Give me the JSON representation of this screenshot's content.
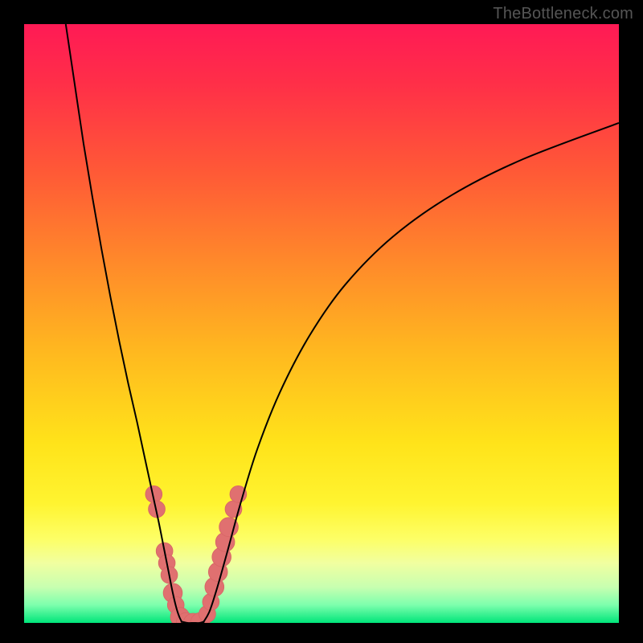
{
  "watermark": "TheBottleneck.com",
  "colors": {
    "black": "#000000",
    "curve": "#000000",
    "marker_fill": "#e07070",
    "marker_stroke": "#d86666"
  },
  "chart_data": {
    "type": "line",
    "title": "",
    "xlabel": "",
    "ylabel": "",
    "xlim": [
      0,
      100
    ],
    "ylim": [
      0,
      100
    ],
    "gradient_stops": [
      {
        "offset": 0.0,
        "color": "#ff1a55"
      },
      {
        "offset": 0.1,
        "color": "#ff2f48"
      },
      {
        "offset": 0.25,
        "color": "#ff5a36"
      },
      {
        "offset": 0.4,
        "color": "#ff8a2a"
      },
      {
        "offset": 0.55,
        "color": "#ffb91f"
      },
      {
        "offset": 0.7,
        "color": "#ffe31a"
      },
      {
        "offset": 0.8,
        "color": "#fff430"
      },
      {
        "offset": 0.86,
        "color": "#fdff66"
      },
      {
        "offset": 0.9,
        "color": "#f1ffa0"
      },
      {
        "offset": 0.94,
        "color": "#c8ffb0"
      },
      {
        "offset": 0.97,
        "color": "#7dffad"
      },
      {
        "offset": 1.0,
        "color": "#00e57a"
      }
    ],
    "series": [
      {
        "name": "left-branch",
        "x": [
          7.0,
          8.5,
          10.0,
          11.5,
          13.0,
          14.5,
          16.0,
          17.5,
          19.0,
          20.3,
          21.5,
          22.6,
          23.5,
          24.3,
          25.0,
          25.6,
          26.1,
          26.5
        ],
        "y": [
          100.0,
          90.0,
          80.0,
          71.0,
          62.5,
          54.5,
          47.0,
          40.0,
          33.5,
          27.5,
          22.0,
          17.0,
          12.5,
          8.5,
          5.0,
          2.5,
          1.0,
          0.2
        ]
      },
      {
        "name": "flat-valley",
        "x": [
          26.5,
          27.5,
          28.5,
          29.5,
          30.2
        ],
        "y": [
          0.2,
          0.0,
          0.0,
          0.0,
          0.2
        ]
      },
      {
        "name": "right-branch",
        "x": [
          30.2,
          31.2,
          32.5,
          34.2,
          36.4,
          39.2,
          43.0,
          48.0,
          54.0,
          62.0,
          72.0,
          84.0,
          100.0
        ],
        "y": [
          0.2,
          2.0,
          6.0,
          12.0,
          20.0,
          29.0,
          38.5,
          48.0,
          56.5,
          64.5,
          71.5,
          77.5,
          83.5
        ]
      }
    ],
    "markers": [
      {
        "x": 21.8,
        "y": 21.5,
        "r": 1.4
      },
      {
        "x": 22.3,
        "y": 19.0,
        "r": 1.4
      },
      {
        "x": 23.6,
        "y": 12.0,
        "r": 1.4
      },
      {
        "x": 24.0,
        "y": 10.0,
        "r": 1.4
      },
      {
        "x": 24.4,
        "y": 8.0,
        "r": 1.4
      },
      {
        "x": 25.0,
        "y": 5.0,
        "r": 1.6
      },
      {
        "x": 25.5,
        "y": 3.0,
        "r": 1.4
      },
      {
        "x": 26.2,
        "y": 1.0,
        "r": 1.6
      },
      {
        "x": 27.2,
        "y": 0.1,
        "r": 1.6
      },
      {
        "x": 28.4,
        "y": 0.0,
        "r": 1.6
      },
      {
        "x": 29.6,
        "y": 0.1,
        "r": 1.6
      },
      {
        "x": 30.8,
        "y": 1.5,
        "r": 1.4
      },
      {
        "x": 31.4,
        "y": 3.5,
        "r": 1.4
      },
      {
        "x": 32.0,
        "y": 6.0,
        "r": 1.6
      },
      {
        "x": 32.6,
        "y": 8.5,
        "r": 1.6
      },
      {
        "x": 33.2,
        "y": 11.0,
        "r": 1.6
      },
      {
        "x": 33.8,
        "y": 13.5,
        "r": 1.6
      },
      {
        "x": 34.4,
        "y": 16.0,
        "r": 1.6
      },
      {
        "x": 35.2,
        "y": 19.0,
        "r": 1.4
      },
      {
        "x": 36.0,
        "y": 21.5,
        "r": 1.4
      }
    ]
  }
}
